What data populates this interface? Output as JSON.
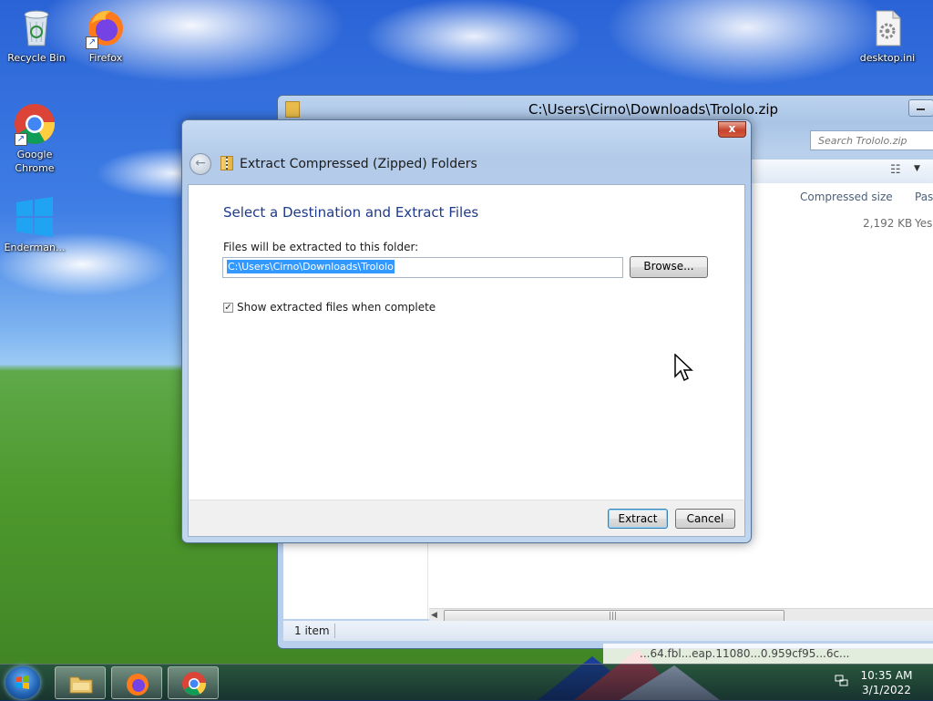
{
  "desktop": {
    "icons": [
      {
        "label": "Recycle Bin"
      },
      {
        "label": "Firefox"
      },
      {
        "label": "Google Chrome"
      },
      {
        "label": "Enderman..."
      },
      {
        "label": "desktop.ini"
      }
    ]
  },
  "explorer": {
    "title": "C:\\Users\\Cirno\\Downloads\\Trololo.zip",
    "search_placeholder": "Search Trololo.zip",
    "columns": {
      "compressed_size": "Compressed size",
      "password": "Pas"
    },
    "row": {
      "compressed_size": "2,192 KB",
      "password": "Yes"
    },
    "status_count": "1 item"
  },
  "dialog": {
    "close_label": "x",
    "title": "Extract Compressed (Zipped) Folders",
    "heading": "Select a Destination and Extract Files",
    "path_label": "Files will be extracted to this folder:",
    "path_value": "C:\\Users\\Cirno\\Downloads\\Trololo",
    "browse_label": "Browse...",
    "checkbox_label": "Show extracted files when complete",
    "checkbox_checked": true,
    "extract_label": "Extract",
    "cancel_label": "Cancel"
  },
  "taskbar": {
    "clock_time": "10:35 AM",
    "clock_date": "3/1/2022",
    "notification_text": "...64.fbl...eap.11080...0.959cf95...6c..."
  }
}
